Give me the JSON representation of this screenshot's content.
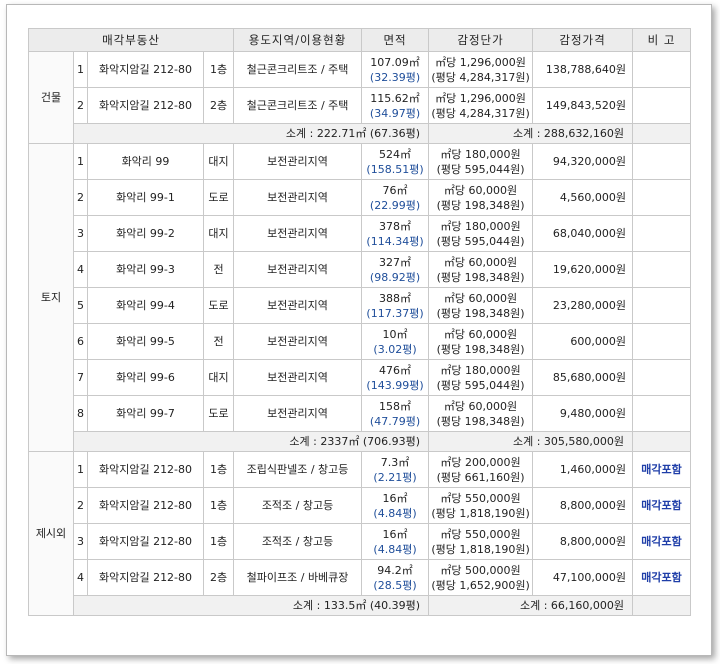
{
  "headers": {
    "property": "매각부동산",
    "zoning": "용도지역/이용현황",
    "area": "면적",
    "unit_price": "감정단가",
    "appraised": "감정가격",
    "note": "비 고"
  },
  "groups": [
    {
      "category": "건물",
      "rows": [
        {
          "no": "1",
          "addr": "화악지암길 212-80",
          "type": "1층",
          "use": "철근콘크리트조 / 주택",
          "area": "107.09㎡",
          "area_py": "(32.39평)",
          "price": "㎡당 1,296,000원",
          "price_py": "(평당 4,284,317원)",
          "appraised": "138,788,640원",
          "note": ""
        },
        {
          "no": "2",
          "addr": "화악지암길 212-80",
          "type": "2층",
          "use": "철근콘크리트조 / 주택",
          "area": "115.62㎡",
          "area_py": "(34.97평)",
          "price": "㎡당 1,296,000원",
          "price_py": "(평당 4,284,317원)",
          "appraised": "149,843,520원",
          "note": ""
        }
      ],
      "subtotal_area": "소계 : 222.71㎡ (67.36평)",
      "subtotal_price": "소계 : 288,632,160원"
    },
    {
      "category": "토지",
      "rows": [
        {
          "no": "1",
          "addr": "화악리 99",
          "type": "대지",
          "use": "보전관리지역",
          "area": "524㎡",
          "area_py": "(158.51평)",
          "price": "㎡당 180,000원",
          "price_py": "(평당 595,044원)",
          "appraised": "94,320,000원",
          "note": ""
        },
        {
          "no": "2",
          "addr": "화악리 99-1",
          "type": "도로",
          "use": "보전관리지역",
          "area": "76㎡",
          "area_py": "(22.99평)",
          "price": "㎡당 60,000원",
          "price_py": "(평당 198,348원)",
          "appraised": "4,560,000원",
          "note": ""
        },
        {
          "no": "3",
          "addr": "화악리 99-2",
          "type": "대지",
          "use": "보전관리지역",
          "area": "378㎡",
          "area_py": "(114.34평)",
          "price": "㎡당 180,000원",
          "price_py": "(평당 595,044원)",
          "appraised": "68,040,000원",
          "note": ""
        },
        {
          "no": "4",
          "addr": "화악리 99-3",
          "type": "전",
          "use": "보전관리지역",
          "area": "327㎡",
          "area_py": "(98.92평)",
          "price": "㎡당 60,000원",
          "price_py": "(평당 198,348원)",
          "appraised": "19,620,000원",
          "note": ""
        },
        {
          "no": "5",
          "addr": "화악리 99-4",
          "type": "도로",
          "use": "보전관리지역",
          "area": "388㎡",
          "area_py": "(117.37평)",
          "price": "㎡당 60,000원",
          "price_py": "(평당 198,348원)",
          "appraised": "23,280,000원",
          "note": ""
        },
        {
          "no": "6",
          "addr": "화악리 99-5",
          "type": "전",
          "use": "보전관리지역",
          "area": "10㎡",
          "area_py": "(3.02평)",
          "price": "㎡당 60,000원",
          "price_py": "(평당 198,348원)",
          "appraised": "600,000원",
          "note": ""
        },
        {
          "no": "7",
          "addr": "화악리 99-6",
          "type": "대지",
          "use": "보전관리지역",
          "area": "476㎡",
          "area_py": "(143.99평)",
          "price": "㎡당 180,000원",
          "price_py": "(평당 595,044원)",
          "appraised": "85,680,000원",
          "note": ""
        },
        {
          "no": "8",
          "addr": "화악리 99-7",
          "type": "도로",
          "use": "보전관리지역",
          "area": "158㎡",
          "area_py": "(47.79평)",
          "price": "㎡당 60,000원",
          "price_py": "(평당 198,348원)",
          "appraised": "9,480,000원",
          "note": ""
        }
      ],
      "subtotal_area": "소계 : 2337㎡ (706.93평)",
      "subtotal_price": "소계 : 305,580,000원"
    },
    {
      "category": "제시외",
      "rows": [
        {
          "no": "1",
          "addr": "화악지암길 212-80",
          "type": "1층",
          "use": "조립식판넬조 / 창고등",
          "area": "7.3㎡",
          "area_py": "(2.21평)",
          "price": "㎡당 200,000원",
          "price_py": "(평당 661,160원)",
          "appraised": "1,460,000원",
          "note": "매각포함"
        },
        {
          "no": "2",
          "addr": "화악지암길 212-80",
          "type": "1층",
          "use": "조적조 / 창고등",
          "area": "16㎡",
          "area_py": "(4.84평)",
          "price": "㎡당 550,000원",
          "price_py": "(평당 1,818,190원)",
          "appraised": "8,800,000원",
          "note": "매각포함"
        },
        {
          "no": "3",
          "addr": "화악지암길 212-80",
          "type": "1층",
          "use": "조적조 / 창고등",
          "area": "16㎡",
          "area_py": "(4.84평)",
          "price": "㎡당 550,000원",
          "price_py": "(평당 1,818,190원)",
          "appraised": "8,800,000원",
          "note": "매각포함"
        },
        {
          "no": "4",
          "addr": "화악지암길 212-80",
          "type": "2층",
          "use": "철파이프조 / 바베큐장",
          "area": "94.2㎡",
          "area_py": "(28.5평)",
          "price": "㎡당 500,000원",
          "price_py": "(평당 1,652,900원)",
          "appraised": "47,100,000원",
          "note": "매각포함"
        }
      ],
      "subtotal_area": "소계 : 133.5㎡ (40.39평)",
      "subtotal_price": "소계 : 66,160,000원"
    }
  ]
}
